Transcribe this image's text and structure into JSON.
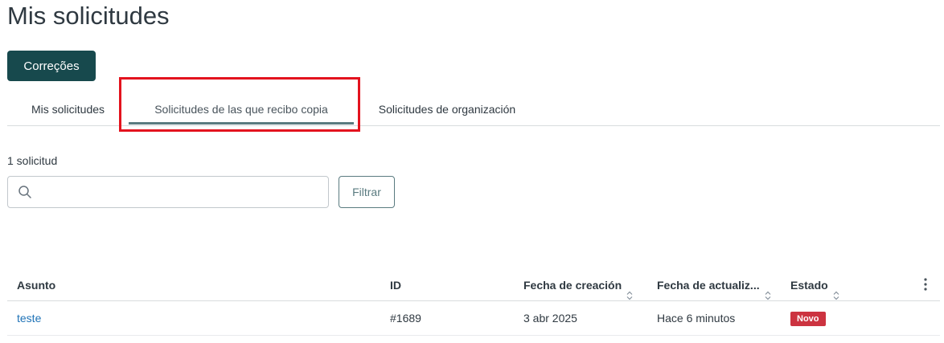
{
  "page": {
    "title": "Mis solicitudes"
  },
  "toolbar": {
    "primary_button_label": "Correções"
  },
  "tabs": [
    {
      "label": "Mis solicitudes",
      "active": false
    },
    {
      "label": "Solicitudes de las que recibo copia",
      "active": true
    },
    {
      "label": "Solicitudes de organización",
      "active": false
    }
  ],
  "results": {
    "count_text": "1 solicitud"
  },
  "search": {
    "placeholder": "",
    "value": "",
    "icon": "search-icon"
  },
  "filter": {
    "label": "Filtrar"
  },
  "table": {
    "columns": [
      {
        "label": "Asunto",
        "sortable": false
      },
      {
        "label": "ID",
        "sortable": false
      },
      {
        "label": "Fecha de creación",
        "sortable": true
      },
      {
        "label": "Fecha de actualiz...",
        "sortable": true
      },
      {
        "label": "Estado",
        "sortable": true
      }
    ],
    "rows": [
      {
        "subject": "teste",
        "id": "#1689",
        "created": "3 abr 2025",
        "updated": "Hace 6 minutos",
        "status": "Novo"
      }
    ]
  },
  "colors": {
    "primary": "#17494d",
    "link": "#1f73b7",
    "status_new": "#cc3340",
    "highlight": "#e3131e"
  }
}
